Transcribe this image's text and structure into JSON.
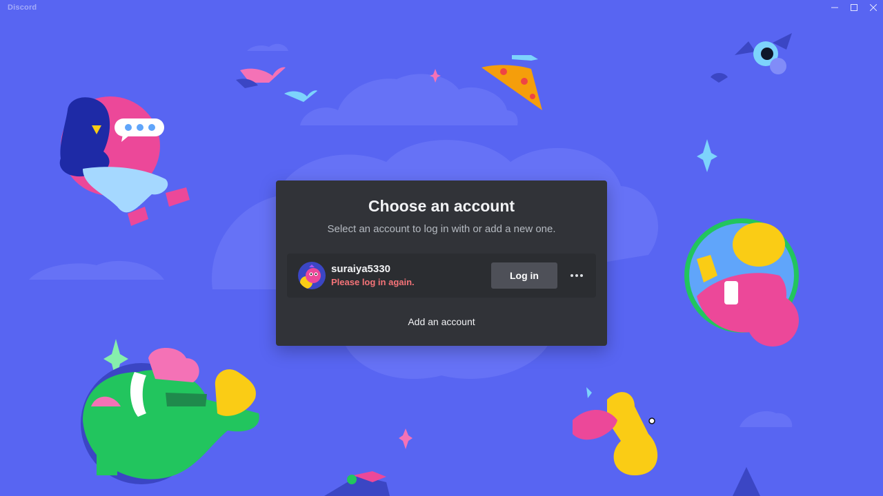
{
  "app": {
    "title": "Discord"
  },
  "window_controls": [
    "minimize-icon",
    "maximize-icon",
    "close-icon"
  ],
  "modal": {
    "title": "Choose an account",
    "subtitle": "Select an account to log in with or add a new one.",
    "accounts": [
      {
        "username": "suraiya5330",
        "status": "Please log in again.",
        "login_label": "Log in"
      }
    ],
    "add_account_label": "Add an account"
  },
  "colors": {
    "background": "#5865f2",
    "modal": "#313338",
    "card": "#2b2d31",
    "button": "#4e5058",
    "error": "#f57378"
  }
}
